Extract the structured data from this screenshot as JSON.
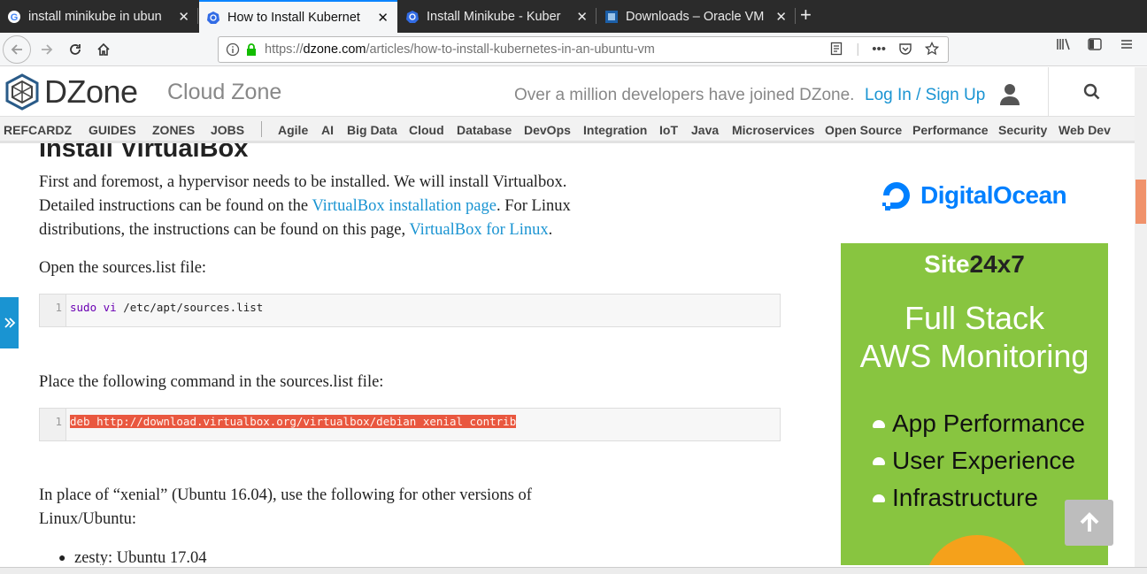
{
  "browser": {
    "tabs": [
      {
        "title": "install minikube in ubun",
        "icon": "google-icon"
      },
      {
        "title": "How to Install Kubernet",
        "icon": "kubernetes-icon",
        "active": true
      },
      {
        "title": "Install Minikube - Kuber",
        "icon": "kubernetes-icon"
      },
      {
        "title": "Downloads – Oracle VM",
        "icon": "virtualbox-icon"
      }
    ],
    "new_tab": "+",
    "close": "✕",
    "url_prefix": "https://",
    "url_domain": "dzone.com",
    "url_path": "/articles/how-to-install-kubernetes-in-an-ubuntu-vm",
    "more": "•••"
  },
  "header": {
    "logo": "DZone",
    "zone": "Cloud Zone",
    "tagline": "Over a million developers have joined DZone.",
    "login": "Log In",
    "slash": "/",
    "signup": "Sign Up"
  },
  "nav": {
    "primary": [
      "REFCARDZ",
      "GUIDES",
      "ZONES",
      "JOBS"
    ],
    "topics": [
      "Agile",
      "AI",
      "Big Data",
      "Cloud",
      "Database",
      "DevOps",
      "Integration",
      "IoT",
      "Java",
      "Microservices",
      "Open Source",
      "Performance",
      "Security",
      "Web Dev"
    ]
  },
  "article": {
    "heading": "Install VirtualBox",
    "p1_a": "First and foremost, a hypervisor needs to be installed. We will install Virtualbox.",
    "p1_b": "Detailed instructions can be found on the ",
    "p1_link1": "VirtualBox installation page",
    "p1_c": ". For Linux",
    "p1_d": "distributions, the instructions can be found on this page, ",
    "p1_link2": "VirtualBox for Linux",
    "p1_e": ".",
    "p2": "Open the sources.list file:",
    "code1_line": "1",
    "code1_kw1": "sudo",
    "code1_kw2": "vi",
    "code1_rest": " /etc/apt/sources.list",
    "p3": "Place the following command in the sources.list file:",
    "code2_line": "1",
    "code2": "deb http://download.virtualbox.org/virtualbox/debian xenial contrib",
    "p4_a": "In place of “xenial” (Ubuntu 16.04), use the following for other versions of",
    "p4_b": "Linux/Ubuntu:",
    "bullet1": "zesty: Ubuntu 17.04"
  },
  "ad": {
    "sponsor": "DigitalOcean",
    "brand_a": "Site",
    "brand_b": "24x7",
    "h1": "Full Stack",
    "h2": "AWS Monitoring",
    "items": [
      "App Performance",
      "User Experience",
      "Infrastructure"
    ]
  },
  "colors": {
    "link": "#1a94d2",
    "ad_green": "#88c540",
    "code_highlight": "#e9573f",
    "do_blue": "#0080ff"
  }
}
